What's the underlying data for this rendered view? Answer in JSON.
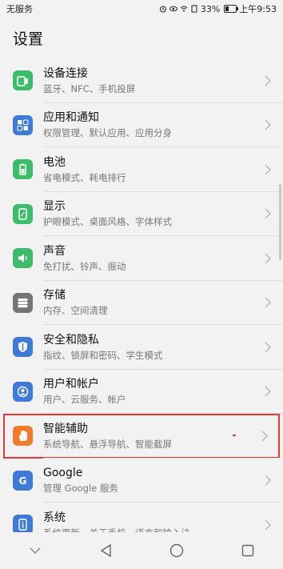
{
  "status": {
    "carrier": "无服务",
    "battery": "33%",
    "battery_level": 0.33,
    "time": "上午9:53"
  },
  "header": {
    "title": "设置"
  },
  "items": [
    {
      "title": "设备连接",
      "subtitle": "蓝牙、NFC、手机投屏",
      "icon": "devices-icon",
      "color": "#3dbd6a"
    },
    {
      "title": "应用和通知",
      "subtitle": "权限管理、默认应用、应用分身",
      "icon": "apps-grid-icon",
      "color": "#3f7bd6"
    },
    {
      "title": "电池",
      "subtitle": "省电模式、耗电排行",
      "icon": "battery-icon",
      "color": "#3dbd6a"
    },
    {
      "title": "显示",
      "subtitle": "护眼模式、桌面风格、字体样式",
      "icon": "display-icon",
      "color": "#3dbd6a"
    },
    {
      "title": "声音",
      "subtitle": "免打扰、铃声、振动",
      "icon": "sound-icon",
      "color": "#3dbd6a"
    },
    {
      "title": "存储",
      "subtitle": "内存、空间清理",
      "icon": "storage-icon",
      "color": "#757575"
    },
    {
      "title": "安全和隐私",
      "subtitle": "指纹、锁屏和密码、学生模式",
      "icon": "shield-icon",
      "color": "#3f7bd6"
    },
    {
      "title": "用户和帐户",
      "subtitle": "用户、云服务、帐户",
      "icon": "user-icon",
      "color": "#3f7bd6"
    },
    {
      "title": "智能辅助",
      "subtitle": "系统导航、悬浮导航、智能截屏",
      "icon": "hand-icon",
      "color": "#f17a2c"
    },
    {
      "title": "Google",
      "subtitle": "管理 Google 服务",
      "icon": "google-icon",
      "color": "#3f7bd6"
    },
    {
      "title": "系统",
      "subtitle": "系统更新、关于手机、语言和输入法",
      "icon": "info-icon",
      "color": "#3f7bd6"
    }
  ]
}
